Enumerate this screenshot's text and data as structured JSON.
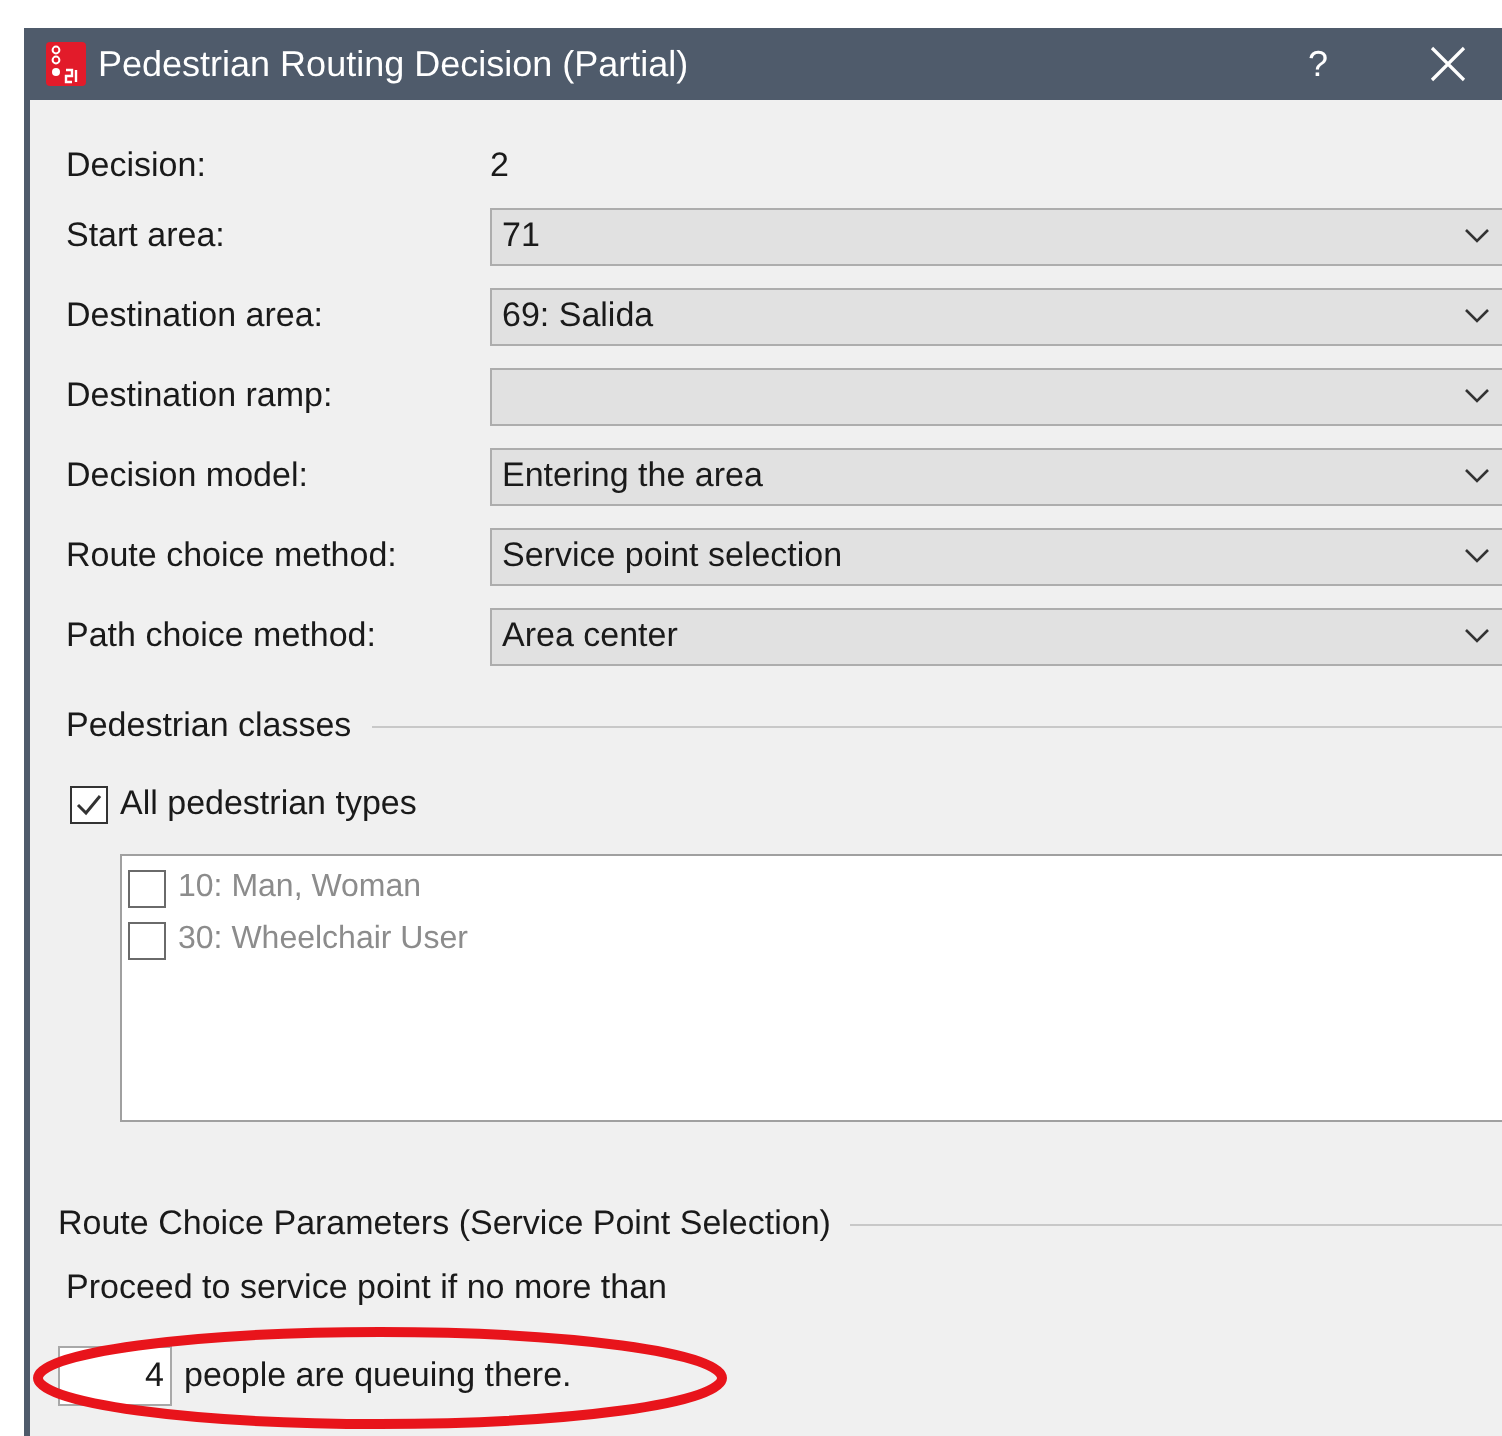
{
  "window": {
    "title": "Pedestrian Routing Decision (Partial)",
    "help": "?"
  },
  "decision": {
    "label": "Decision:",
    "value": "2"
  },
  "dropdowns": [
    {
      "label": "Start area:",
      "value": "71"
    },
    {
      "label": "Destination area:",
      "value": "69: Salida"
    },
    {
      "label": "Destination ramp:"
    },
    {
      "label": "Decision model:",
      "value": "Entering the area"
    },
    {
      "label": "Route choice method:",
      "value": "Service point selection"
    },
    {
      "label": "Path choice method:",
      "value": "Area center"
    }
  ],
  "pedestrian_classes": {
    "title": "Pedestrian classes",
    "all_types": {
      "label": "All pedestrian types",
      "checked": true
    },
    "items": [
      {
        "label": "10: Man, Woman",
        "checked": false
      },
      {
        "label": "30: Wheelchair User",
        "checked": false
      }
    ]
  },
  "route_choice_parameters": {
    "title": "Route Choice Parameters (Service Point Selection)",
    "prompt": "Proceed to service point if no more than",
    "queue_limit": "4",
    "suffix": "people are queuing there."
  },
  "annotations": [
    {
      "kind": "ellipse"
    }
  ]
}
